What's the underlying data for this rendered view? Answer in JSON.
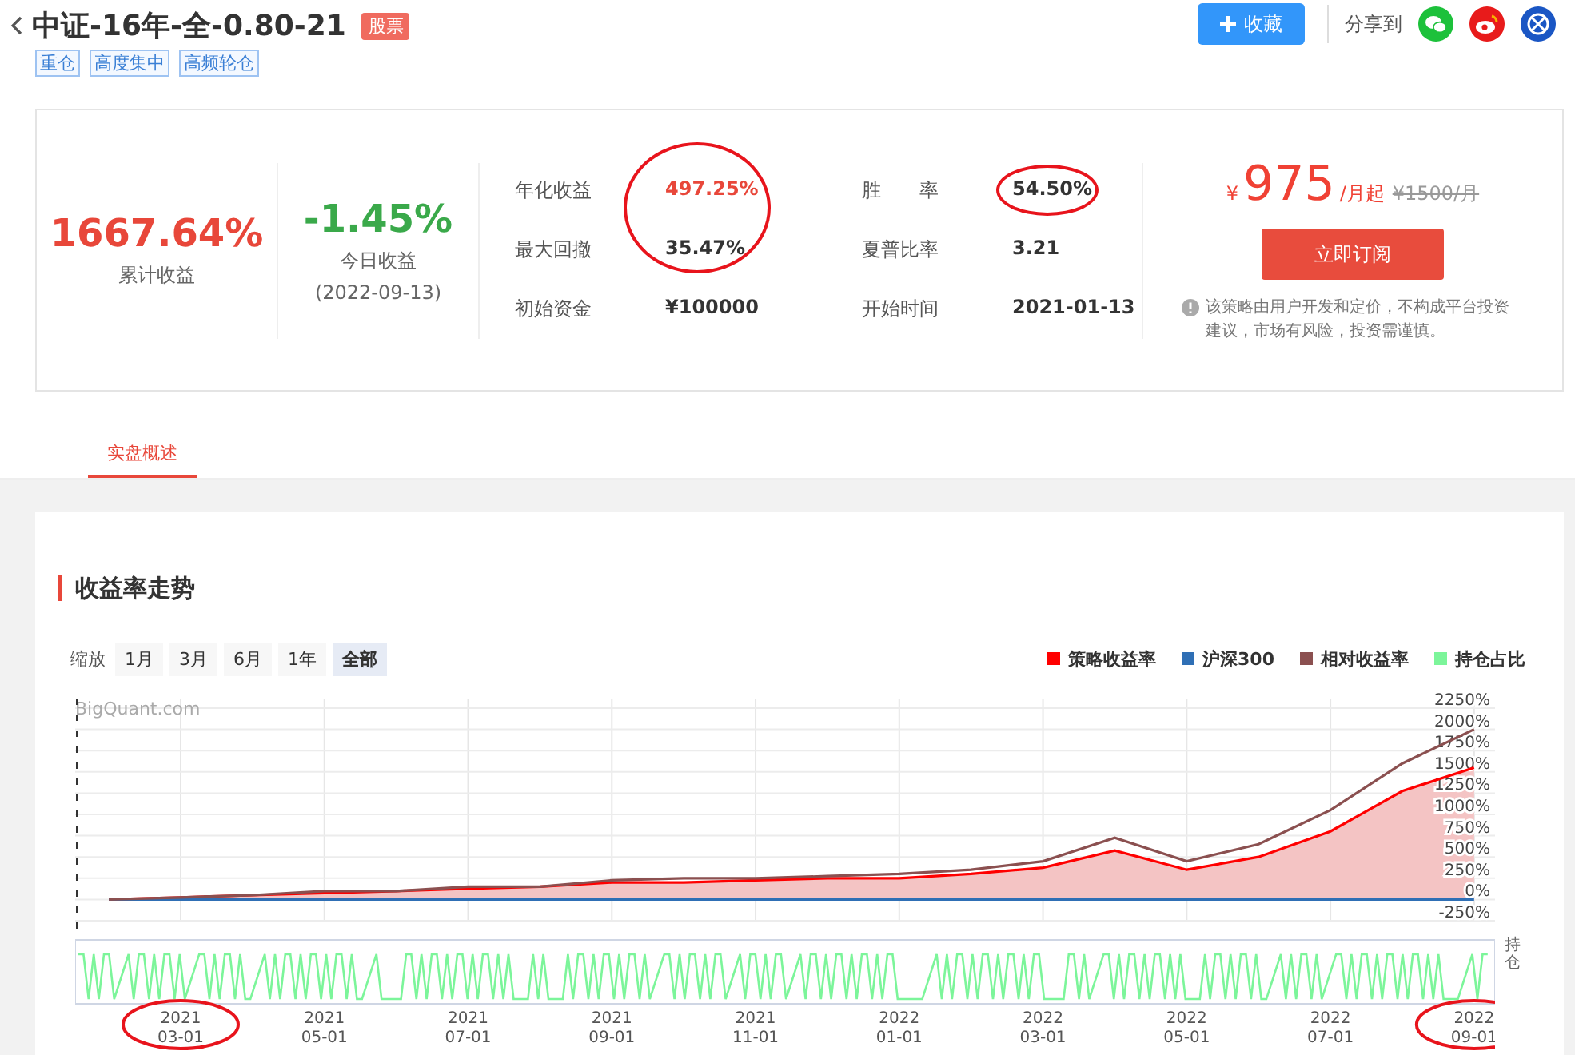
{
  "header": {
    "title": "中证-16年-全-0.80-21",
    "badge": "股票",
    "tags": [
      "重仓",
      "高度集中",
      "高频轮仓"
    ],
    "favorite_button": "收藏",
    "share_label": "分享到"
  },
  "summary": {
    "total_return": {
      "value": "1667.64%",
      "label": "累计收益"
    },
    "today": {
      "value": "-1.45%",
      "label": "今日收益",
      "date": "(2022-09-13)"
    },
    "metrics": [
      {
        "label": "年化收益",
        "value": "497.25%",
        "emphasis": true,
        "circled": true
      },
      {
        "label": "胜　　率",
        "value": "54.50%",
        "emphasis": false,
        "circled": true
      },
      {
        "label": "最大回撤",
        "value": "35.47%",
        "emphasis": false,
        "circled": true
      },
      {
        "label": "夏普比率",
        "value": "3.21",
        "emphasis": false
      },
      {
        "label": "初始资金",
        "value": "¥100000",
        "emphasis": false
      },
      {
        "label": "开始时间",
        "value": "2021-01-13",
        "emphasis": false
      }
    ],
    "price": {
      "currency": "¥",
      "amount": "975",
      "unit": "/月起",
      "original": "¥1500/月",
      "button": "立即订阅",
      "notice": "该策略由用户开发和定价，不构成平台投资建议，市场有风险，投资需谨慎。"
    }
  },
  "tabs": [
    {
      "label": "实盘概述",
      "selected": true
    }
  ],
  "returns": {
    "title": "收益率走势",
    "zoom_label": "缩放",
    "zoom_options": [
      {
        "label": "1月",
        "selected": false
      },
      {
        "label": "3月",
        "selected": false
      },
      {
        "label": "6月",
        "selected": false
      },
      {
        "label": "1年",
        "selected": false
      },
      {
        "label": "全部",
        "selected": true
      }
    ],
    "credit": "BigQuant.com",
    "holdings_legend": {
      "name": "持仓占比",
      "color": "#7cf59a"
    },
    "navigator_label": "持仓",
    "chart_data": {
      "type": "line",
      "categories": [
        null,
        "2021\n03-01",
        null,
        "2021\n05-01",
        null,
        "2021\n07-01",
        null,
        "2021\n09-01",
        null,
        "2021\n11-01",
        null,
        "2022\n01-01",
        null,
        "2022\n03-01",
        null,
        "2022\n05-01",
        null,
        "2022\n07-01",
        null,
        "2022\n09-01"
      ],
      "series": [
        {
          "name": "策略收益率",
          "color": "#ff0000",
          "values": [
            0,
            25,
            50,
            75,
            100,
            125,
            150,
            200,
            200,
            225,
            250,
            250,
            300,
            375,
            575,
            350,
            500,
            800,
            1275,
            1550
          ]
        },
        {
          "name": "沪深300",
          "color": "#2f6fb5",
          "values": [
            0,
            0,
            0,
            0,
            0,
            0,
            0,
            0,
            0,
            0,
            0,
            0,
            0,
            0,
            0,
            0,
            0,
            0,
            0,
            0
          ]
        },
        {
          "name": "相对收益率",
          "color": "#8b5050",
          "values": [
            0,
            25,
            50,
            100,
            100,
            150,
            150,
            225,
            250,
            250,
            275,
            300,
            350,
            450,
            725,
            450,
            650,
            1050,
            1600,
            2000
          ]
        }
      ],
      "ylim": [
        -250,
        2250
      ],
      "grid": true,
      "yticks": [
        {
          "value": -250,
          "label": "-250%"
        },
        {
          "value": 0,
          "label": "0%"
        },
        {
          "value": 250,
          "label": "250%"
        },
        {
          "value": 500,
          "label": "500%"
        },
        {
          "value": 750,
          "label": "750%"
        },
        {
          "value": 1000,
          "label": "1000%"
        },
        {
          "value": 1250,
          "label": "1250%"
        },
        {
          "value": 1500,
          "label": "1500%"
        },
        {
          "value": 1750,
          "label": "1750%"
        },
        {
          "value": 2000,
          "label": "2000%"
        },
        {
          "value": 2250,
          "label": "2250%"
        }
      ]
    },
    "label_circles": [
      true,
      false,
      false,
      false,
      false,
      false,
      false,
      false,
      false,
      true
    ]
  }
}
